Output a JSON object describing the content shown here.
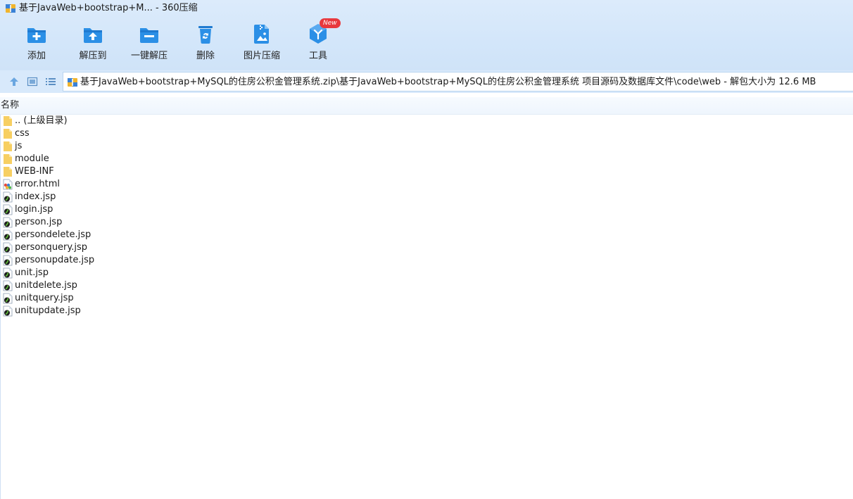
{
  "window": {
    "title": "基于JavaWeb+bootstrap+M... - 360压缩"
  },
  "toolbar": {
    "items": [
      {
        "label": "添加",
        "icon": "add-folder-icon"
      },
      {
        "label": "解压到",
        "icon": "extract-to-icon"
      },
      {
        "label": "一键解压",
        "icon": "one-click-extract-icon"
      },
      {
        "label": "删除",
        "icon": "recycle-delete-icon"
      },
      {
        "label": "图片压缩",
        "icon": "image-compress-icon"
      },
      {
        "label": "工具",
        "icon": "tools-cube-icon",
        "badge": "New"
      }
    ]
  },
  "nav": {
    "up_icon": "arrow-up-icon",
    "thumbnail_view_icon": "thumbnail-view-icon",
    "list_view_icon": "list-view-icon",
    "path": "基于JavaWeb+bootstrap+MySQL的住房公积金管理系统.zip\\基于JavaWeb+bootstrap+MySQL的住房公积金管理系统 项目源码及数据库文件\\code\\web - 解包大小为 12.6 MB"
  },
  "list": {
    "column_name": "名称",
    "files": [
      {
        "name": ".. (上级目录)",
        "type": "folder"
      },
      {
        "name": "css",
        "type": "folder"
      },
      {
        "name": "js",
        "type": "folder"
      },
      {
        "name": "module",
        "type": "folder"
      },
      {
        "name": "WEB-INF",
        "type": "folder"
      },
      {
        "name": "error.html",
        "type": "html"
      },
      {
        "name": "index.jsp",
        "type": "jsp"
      },
      {
        "name": "login.jsp",
        "type": "jsp"
      },
      {
        "name": "person.jsp",
        "type": "jsp"
      },
      {
        "name": "persondelete.jsp",
        "type": "jsp"
      },
      {
        "name": "personquery.jsp",
        "type": "jsp"
      },
      {
        "name": "personupdate.jsp",
        "type": "jsp"
      },
      {
        "name": "unit.jsp",
        "type": "jsp"
      },
      {
        "name": "unitdelete.jsp",
        "type": "jsp"
      },
      {
        "name": "unitquery.jsp",
        "type": "jsp"
      },
      {
        "name": "unitupdate.jsp",
        "type": "jsp"
      }
    ]
  },
  "colors": {
    "accent": "#2b8fe6",
    "toolbar_bg": "#d3e6fa",
    "badge": "#e8383d",
    "folder": "#f7cf62"
  }
}
